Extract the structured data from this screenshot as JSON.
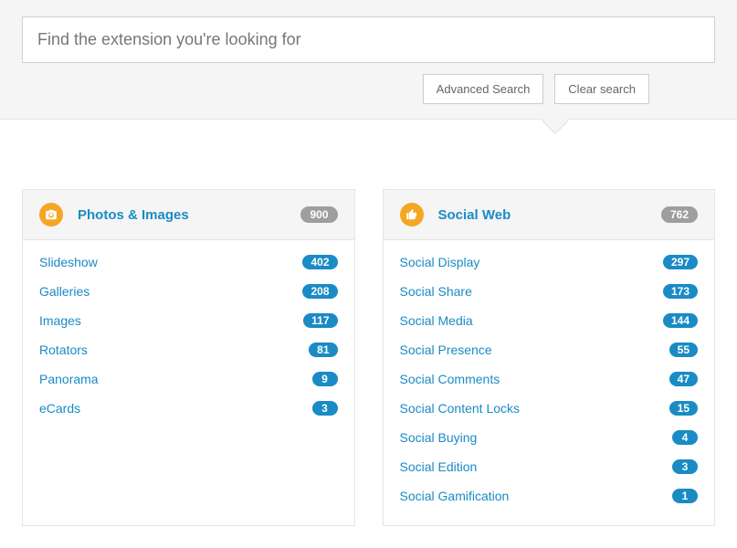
{
  "search": {
    "placeholder": "Find the extension you're looking for",
    "advanced_label": "Advanced Search",
    "clear_label": "Clear search"
  },
  "categories": [
    {
      "title": "Photos & Images",
      "icon": "camera",
      "total": "900",
      "items": [
        {
          "label": "Slideshow",
          "count": "402"
        },
        {
          "label": "Galleries",
          "count": "208"
        },
        {
          "label": "Images",
          "count": "117"
        },
        {
          "label": "Rotators",
          "count": "81"
        },
        {
          "label": "Panorama",
          "count": "9"
        },
        {
          "label": "eCards",
          "count": "3"
        }
      ]
    },
    {
      "title": "Social Web",
      "icon": "thumbs-up",
      "total": "762",
      "items": [
        {
          "label": "Social Display",
          "count": "297"
        },
        {
          "label": "Social Share",
          "count": "173"
        },
        {
          "label": "Social Media",
          "count": "144"
        },
        {
          "label": "Social Presence",
          "count": "55"
        },
        {
          "label": "Social Comments",
          "count": "47"
        },
        {
          "label": "Social Content Locks",
          "count": "15"
        },
        {
          "label": "Social Buying",
          "count": "4"
        },
        {
          "label": "Social Edition",
          "count": "3"
        },
        {
          "label": "Social Gamification",
          "count": "1"
        }
      ]
    }
  ]
}
